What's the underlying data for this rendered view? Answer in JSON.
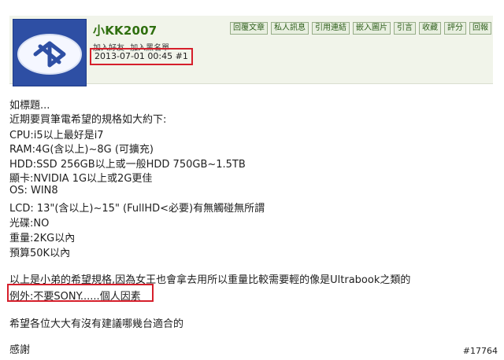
{
  "post": {
    "username": "小KK2007",
    "user_links": [
      "加入好友",
      "加入黑名單"
    ],
    "timestamp": "2013-07-01 00:45",
    "post_number": "#1",
    "toolbar_buttons": [
      "回覆文章",
      "私人訊息",
      "引用連結",
      "嵌入圖片",
      "引言",
      "收藏",
      "評分",
      "回報"
    ]
  },
  "content": {
    "lines": [
      "如標題...",
      "近期要買筆電希望的規格如大約下:",
      "CPU:i5以上最好是i7",
      "RAM:4G(含以上)~8G (可擴充)",
      "HDD:SSD 256GB以上或一般HDD 750GB~1.5TB",
      "顯卡:NVIDIA 1G以上或2G更佳",
      "OS: WIN8",
      "LCD: 13\"(含以上)~15\" (FullHD<必要)有無觸碰無所謂",
      "光碟:NO",
      "重量:2KG以內",
      "預算50K以內",
      "以上是小弟的希望規格,因為女王也會拿去用所以重量比較需要輕的像是Ultrabook之類的",
      "例外:不要SONY......個人因素",
      "希望各位大大有沒有建議哪幾台適合的",
      "感謝"
    ]
  },
  "watermark": "#17764",
  "colors": {
    "username": "#2f6f0f",
    "highlight": "#d61f2b",
    "header_band": "#f1f4ea",
    "avatar_bg": "#2e4fa4"
  },
  "icons": {
    "avatar": "bluetooth-logo-icon"
  }
}
